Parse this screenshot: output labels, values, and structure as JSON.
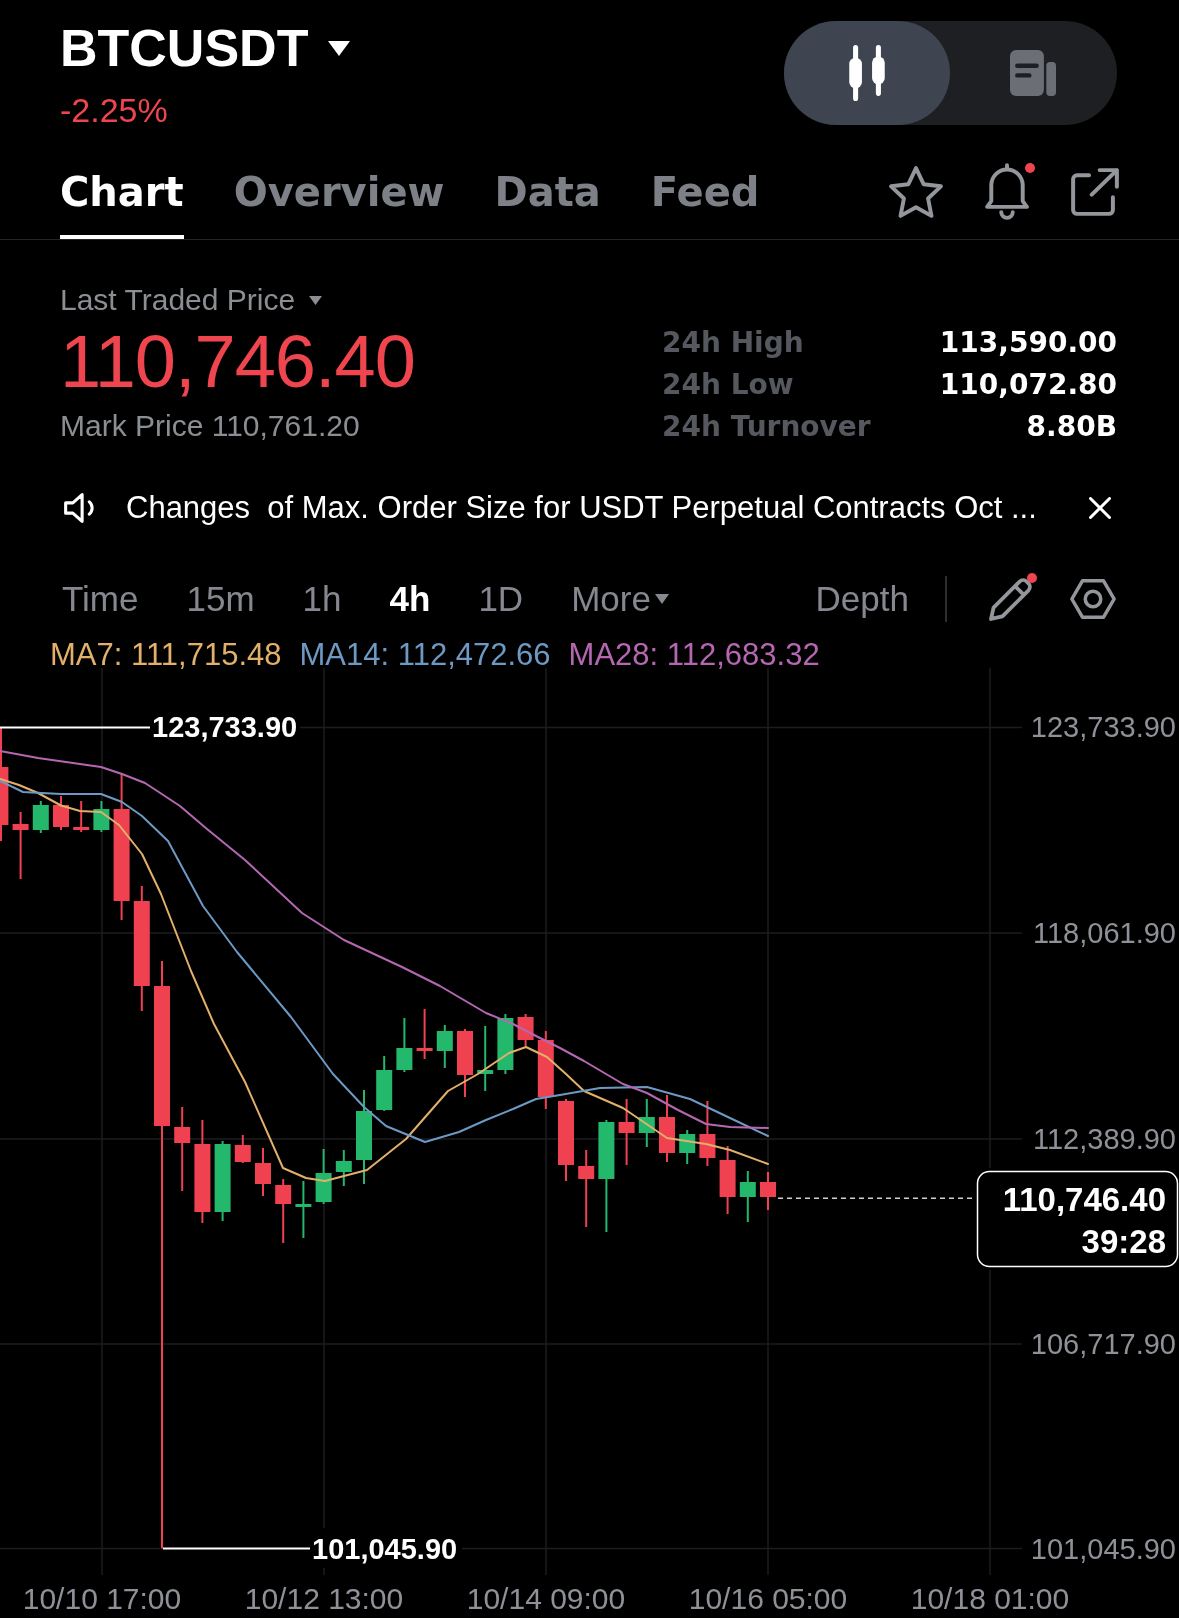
{
  "header": {
    "symbol": "BTCUSDT",
    "change": "-2.25%",
    "falling": true
  },
  "view_toggle": [
    {
      "kind": "chart",
      "selected": true
    },
    {
      "kind": "document",
      "selected": false
    }
  ],
  "tabs": [
    {
      "label": "Chart",
      "selected": true
    },
    {
      "label": "Overview",
      "selected": false
    },
    {
      "label": "Data",
      "selected": false
    },
    {
      "label": "Feed",
      "selected": false
    }
  ],
  "header_actions": [
    {
      "kind": "star",
      "dot": false
    },
    {
      "kind": "bell",
      "dot": true
    },
    {
      "kind": "share",
      "dot": false
    }
  ],
  "price": {
    "selector": "Last Traded Price",
    "last": "110,746.40",
    "mark": "Mark Price 110,761.20"
  },
  "stats": [
    {
      "label": "24h High",
      "value": "113,590.00"
    },
    {
      "label": "24h Low",
      "value": "110,072.80"
    },
    {
      "label": "24h Turnover",
      "value": "8.80B"
    }
  ],
  "announcement": {
    "text": "Changes  of Max. Order Size for USDT Perpetual Contracts Oct ..."
  },
  "intervals": [
    {
      "label": "Time",
      "selected": false,
      "kind": "option"
    },
    {
      "label": "15m",
      "selected": false,
      "kind": "option"
    },
    {
      "label": "1h",
      "selected": false,
      "kind": "option"
    },
    {
      "label": "4h",
      "selected": true,
      "kind": "option"
    },
    {
      "label": "1D",
      "selected": false,
      "kind": "option"
    },
    {
      "label": "More",
      "selected": false,
      "kind": "menu"
    }
  ],
  "depth": {
    "label": "Depth",
    "selected": false
  },
  "tools": [
    {
      "kind": "pencil",
      "dot": true
    },
    {
      "kind": "settings",
      "dot": false
    }
  ],
  "chart": {
    "ma_legend": [
      {
        "label": "MA7: 111,715.48",
        "color": "#e2b06a"
      },
      {
        "label": "MA14: 112,472.66",
        "color": "#6d9ac4"
      },
      {
        "label": "MA28: 112,683.32",
        "color": "#b567b2"
      }
    ],
    "y_labels": [
      "123,733.90",
      "118,061.90",
      "112,389.90",
      "106,717.90",
      "101,045.90"
    ],
    "x_labels": [
      "10/10 17:00",
      "10/12 13:00",
      "10/14 09:00",
      "10/16 05:00",
      "10/18 01:00"
    ],
    "high_label": "123,733.90",
    "low_label": "101,045.90",
    "price_tag": {
      "price": "110,746.40",
      "countdown": "39:28"
    }
  }
}
